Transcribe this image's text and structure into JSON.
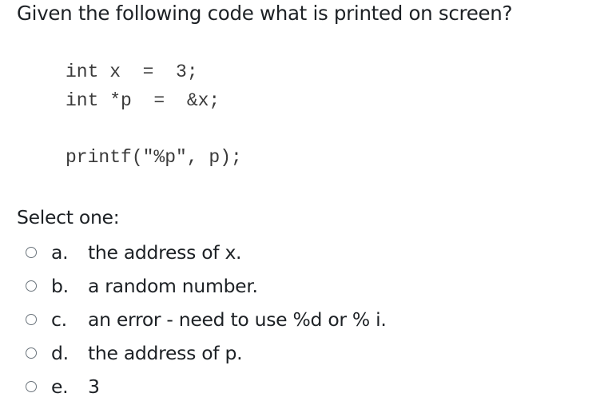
{
  "question": {
    "text": "Given the following code what is printed on screen?"
  },
  "code": {
    "lines": [
      "int x  =  3;",
      "int *p  =  &x;",
      "printf(\"%p\", p);"
    ]
  },
  "prompt": "Select one:",
  "options": [
    {
      "letter": "a.",
      "text": "the address of x.",
      "selected": false
    },
    {
      "letter": "b.",
      "text": "a random number.",
      "selected": false
    },
    {
      "letter": "c.",
      "text": "an error - need to use %d or % i.",
      "selected": false
    },
    {
      "letter": "d.",
      "text": "the address of p.",
      "selected": false
    },
    {
      "letter": "e.",
      "text": "3",
      "selected": false
    }
  ]
}
